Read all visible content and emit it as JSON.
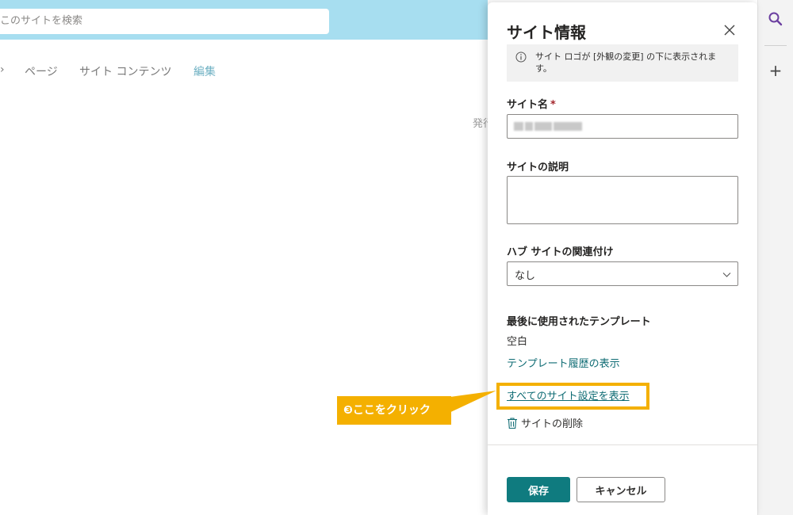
{
  "header": {
    "search_placeholder": "このサイトを検索"
  },
  "site_nav": {
    "items": [
      "ページ",
      "サイト コンテンツ",
      "編集"
    ],
    "partial_text": "発行"
  },
  "panel": {
    "title": "サイト情報",
    "info_text": "サイト ロゴが [外観の変更] の下に表示されます。",
    "site_name_label": "サイト名",
    "required_mark": "*",
    "site_description_label": "サイトの説明",
    "hub_label": "ハブ サイトの関連付け",
    "hub_value": "なし",
    "template_label": "最後に使用されたテンプレート",
    "template_value": "空白",
    "template_history_link": "テンプレート履歴の表示",
    "all_settings_link": "すべてのサイト設定を表示",
    "delete_label": "サイトの削除",
    "save_label": "保存",
    "cancel_label": "キャンセル"
  },
  "callout": {
    "text": "❸ここをクリック"
  },
  "colors": {
    "banner": "#a7def0",
    "accent": "#0f7b7f",
    "highlight": "#f4b000"
  },
  "icons": [
    "search-icon",
    "plus-icon",
    "close-icon",
    "info-icon",
    "chevron-down-icon",
    "trash-icon"
  ]
}
